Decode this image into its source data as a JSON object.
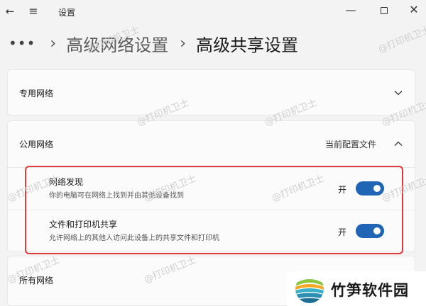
{
  "window": {
    "title": "设置"
  },
  "breadcrumb": {
    "more": "•••",
    "items": [
      "高级网络设置"
    ],
    "current": "高级共享设置"
  },
  "sections": {
    "private": {
      "label": "专用网络"
    },
    "public": {
      "label": "公用网络",
      "profile_status": "当前配置文件",
      "settings": [
        {
          "title": "网络发现",
          "description": "你的电脑可在网络上找到并由其他设备找到",
          "state_label": "开",
          "enabled": true
        },
        {
          "title": "文件和打印机共享",
          "description": "允许网络上的其他人访问此设备上的共享文件和打印机",
          "state_label": "开",
          "enabled": true
        }
      ]
    },
    "all": {
      "label": "所有网络"
    }
  },
  "watermark": "@打印机卫士",
  "logo": {
    "text": "竹笋软件园"
  },
  "colors": {
    "accent": "#1f64b5",
    "highlight": "#e23a3a",
    "background": "#f3f3f3"
  },
  "icons": {
    "back": "back-arrow-icon",
    "menu": "hamburger-menu-icon",
    "minimize": "minimize-icon",
    "maximize": "maximize-icon",
    "close": "close-icon",
    "expand": "chevron-down-icon",
    "collapse": "chevron-up-icon"
  }
}
